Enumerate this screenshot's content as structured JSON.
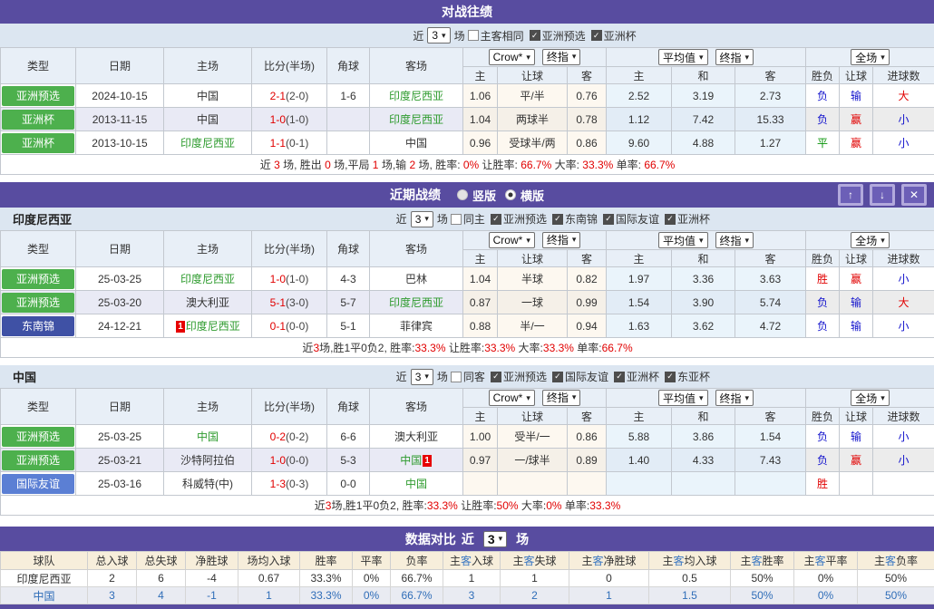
{
  "icons": {
    "chevron": "▾",
    "check": "✓",
    "up": "↑",
    "down": "↓",
    "close": "✕"
  },
  "colors": {
    "purple": "#584ca0",
    "badge_green": "#4db04d",
    "badge_navy": "#3f51a5",
    "badge_blue": "#5b7fd4",
    "result_red": "#e10000",
    "result_blue": "#1212cc",
    "result_green": "#089408",
    "team_green": "#2e9b2e"
  },
  "shared_headers": {
    "static": [
      "类型",
      "日期",
      "主场",
      "比分(半场)",
      "角球",
      "客场"
    ],
    "group_selects": [
      [
        "Crow*",
        "终指"
      ],
      [
        "平均值",
        "终指"
      ],
      [
        "全场"
      ]
    ],
    "sub": [
      "主",
      "让球",
      "客",
      "主",
      "和",
      "客",
      "胜负",
      "让球",
      "进球数"
    ]
  },
  "h2h": {
    "title": "对战往绩",
    "filter": {
      "near": "近",
      "select": "3",
      "games": "场",
      "checks": [
        {
          "label": "主客相同",
          "checked": false
        },
        {
          "label": "亚洲预选",
          "checked": true
        },
        {
          "label": "亚洲杯",
          "checked": true
        }
      ]
    },
    "table": {
      "rows": [
        {
          "league": {
            "label": "亚洲预选",
            "color": "green"
          },
          "date": "2024-10-15",
          "home": {
            "name": "中国",
            "green": false
          },
          "score_ft": "2-1",
          "score_ht": "(2-0)",
          "corner": "1-6",
          "away": {
            "name": "印度尼西亚",
            "green": true
          },
          "odds": [
            "1.06",
            "平/半",
            "0.76"
          ],
          "avg": [
            "2.52",
            "3.19",
            "2.73"
          ],
          "result": [
            {
              "t": "负",
              "c": "blue"
            },
            {
              "t": "输",
              "c": "blue"
            },
            {
              "t": "大",
              "c": "red"
            }
          ]
        },
        {
          "league": {
            "label": "亚洲杯",
            "color": "green"
          },
          "date": "2013-11-15",
          "home": {
            "name": "中国",
            "green": false
          },
          "score_ft": "1-0",
          "score_ht": "(1-0)",
          "corner": "",
          "away": {
            "name": "印度尼西亚",
            "green": true
          },
          "odds": [
            "1.04",
            "两球半",
            "0.78"
          ],
          "avg": [
            "1.12",
            "7.42",
            "15.33"
          ],
          "result": [
            {
              "t": "负",
              "c": "blue"
            },
            {
              "t": "赢",
              "c": "red"
            },
            {
              "t": "小",
              "c": "blue"
            }
          ]
        },
        {
          "league": {
            "label": "亚洲杯",
            "color": "green"
          },
          "date": "2013-10-15",
          "home": {
            "name": "印度尼西亚",
            "green": true
          },
          "score_ft": "1-1",
          "score_ht": "(0-1)",
          "corner": "",
          "away": {
            "name": "中国",
            "green": false
          },
          "odds": [
            "0.96",
            "受球半/两",
            "0.86"
          ],
          "avg": [
            "9.60",
            "4.88",
            "1.27"
          ],
          "result": [
            {
              "t": "平",
              "c": "green"
            },
            {
              "t": "赢",
              "c": "red"
            },
            {
              "t": "小",
              "c": "blue"
            }
          ]
        }
      ],
      "summary": [
        {
          "t": "近 "
        },
        {
          "t": "3",
          "c": "r"
        },
        {
          "t": " 场, 胜出 "
        },
        {
          "t": "0",
          "c": "r"
        },
        {
          "t": " 场,平局 "
        },
        {
          "t": "1",
          "c": "r"
        },
        {
          "t": " 场,输 "
        },
        {
          "t": "2",
          "c": "r"
        },
        {
          "t": " 场, 胜率: "
        },
        {
          "t": "0%",
          "c": "r"
        },
        {
          "t": " 让胜率: "
        },
        {
          "t": "66.7%",
          "c": "r"
        },
        {
          "t": " 大率: "
        },
        {
          "t": "33.3%",
          "c": "r"
        },
        {
          "t": " 单率: "
        },
        {
          "t": "66.7%",
          "c": "r"
        }
      ]
    }
  },
  "recent": {
    "title": "近期战绩",
    "radios": [
      {
        "label": "竖版",
        "selected": false
      },
      {
        "label": "横版",
        "selected": true
      }
    ],
    "buttons": {
      "up": "↑",
      "down": "↓",
      "close": "✕"
    },
    "teams": [
      {
        "label": "印度尼西亚",
        "filter": {
          "near": "近",
          "select": "3",
          "games": "场",
          "checks": [
            {
              "label": "同主",
              "checked": false
            },
            {
              "label": "亚洲预选",
              "checked": true
            },
            {
              "label": "东南锦",
              "checked": true
            },
            {
              "label": "国际友谊",
              "checked": true
            },
            {
              "label": "亚洲杯",
              "checked": true
            }
          ]
        },
        "table": {
          "rows": [
            {
              "league": {
                "label": "亚洲预选",
                "color": "green"
              },
              "date": "25-03-25",
              "home": {
                "name": "印度尼西亚",
                "green": true
              },
              "score_ft": "1-0",
              "score_ht": "(1-0)",
              "corner": "4-3",
              "away": {
                "name": "巴林",
                "green": false
              },
              "odds": [
                "1.04",
                "半球",
                "0.82"
              ],
              "avg": [
                "1.97",
                "3.36",
                "3.63"
              ],
              "result": [
                {
                  "t": "胜",
                  "c": "red"
                },
                {
                  "t": "赢",
                  "c": "red"
                },
                {
                  "t": "小",
                  "c": "blue"
                }
              ]
            },
            {
              "league": {
                "label": "亚洲预选",
                "color": "green"
              },
              "date": "25-03-20",
              "home": {
                "name": "澳大利亚",
                "green": false
              },
              "score_ft": "5-1",
              "score_ht": "(3-0)",
              "corner": "5-7",
              "away": {
                "name": "印度尼西亚",
                "green": true
              },
              "odds": [
                "0.87",
                "一球",
                "0.99"
              ],
              "avg": [
                "1.54",
                "3.90",
                "5.74"
              ],
              "result": [
                {
                  "t": "负",
                  "c": "blue"
                },
                {
                  "t": "输",
                  "c": "blue"
                },
                {
                  "t": "大",
                  "c": "red"
                }
              ]
            },
            {
              "league": {
                "label": "东南锦",
                "color": "navy"
              },
              "date": "24-12-21",
              "home": {
                "name": "印度尼西亚",
                "green": true,
                "badge": "1",
                "badge_pos": "before"
              },
              "score_ft": "0-1",
              "score_ht": "(0-0)",
              "corner": "5-1",
              "away": {
                "name": "菲律宾",
                "green": false
              },
              "odds": [
                "0.88",
                "半/一",
                "0.94"
              ],
              "avg": [
                "1.63",
                "3.62",
                "4.72"
              ],
              "result": [
                {
                  "t": "负",
                  "c": "blue"
                },
                {
                  "t": "输",
                  "c": "blue"
                },
                {
                  "t": "小",
                  "c": "blue"
                }
              ]
            }
          ],
          "summary": [
            {
              "t": "近"
            },
            {
              "t": "3",
              "c": "r"
            },
            {
              "t": "场,胜1平0负2, 胜率:"
            },
            {
              "t": "33.3%",
              "c": "r"
            },
            {
              "t": " 让胜率:"
            },
            {
              "t": "33.3%",
              "c": "r"
            },
            {
              "t": " 大率:"
            },
            {
              "t": "33.3%",
              "c": "r"
            },
            {
              "t": " 单率:"
            },
            {
              "t": "66.7%",
              "c": "r"
            }
          ]
        }
      },
      {
        "label": "中国",
        "filter": {
          "near": "近",
          "select": "3",
          "games": "场",
          "checks": [
            {
              "label": "同客",
              "checked": false
            },
            {
              "label": "亚洲预选",
              "checked": true
            },
            {
              "label": "国际友谊",
              "checked": true
            },
            {
              "label": "亚洲杯",
              "checked": true
            },
            {
              "label": "东亚杯",
              "checked": true
            }
          ]
        },
        "table": {
          "rows": [
            {
              "league": {
                "label": "亚洲预选",
                "color": "green"
              },
              "date": "25-03-25",
              "home": {
                "name": "中国",
                "green": true
              },
              "score_ft": "0-2",
              "score_ht": "(0-2)",
              "corner": "6-6",
              "away": {
                "name": "澳大利亚",
                "green": false
              },
              "odds": [
                "1.00",
                "受半/一",
                "0.86"
              ],
              "avg": [
                "5.88",
                "3.86",
                "1.54"
              ],
              "result": [
                {
                  "t": "负",
                  "c": "blue"
                },
                {
                  "t": "输",
                  "c": "blue"
                },
                {
                  "t": "小",
                  "c": "blue"
                }
              ]
            },
            {
              "league": {
                "label": "亚洲预选",
                "color": "green"
              },
              "date": "25-03-21",
              "home": {
                "name": "沙特阿拉伯",
                "green": false
              },
              "score_ft": "1-0",
              "score_ht": "(0-0)",
              "corner": "5-3",
              "away": {
                "name": "中国",
                "green": true,
                "badge": "1",
                "badge_pos": "after"
              },
              "odds": [
                "0.97",
                "一/球半",
                "0.89"
              ],
              "avg": [
                "1.40",
                "4.33",
                "7.43"
              ],
              "result": [
                {
                  "t": "负",
                  "c": "blue"
                },
                {
                  "t": "赢",
                  "c": "red"
                },
                {
                  "t": "小",
                  "c": "blue"
                }
              ]
            },
            {
              "league": {
                "label": "国际友谊",
                "color": "blue"
              },
              "date": "25-03-16",
              "home": {
                "name": "科威特(中)",
                "green": false
              },
              "score_ft": "1-3",
              "score_ht": "(0-3)",
              "corner": "0-0",
              "away": {
                "name": "中国",
                "green": true
              },
              "odds": [
                "",
                "",
                ""
              ],
              "avg": [
                "",
                "",
                ""
              ],
              "result": [
                {
                  "t": "胜",
                  "c": "red"
                },
                {
                  "t": ""
                },
                {
                  "t": ""
                }
              ]
            }
          ],
          "summary": [
            {
              "t": "近"
            },
            {
              "t": "3",
              "c": "r"
            },
            {
              "t": "场,胜1平0负2, 胜率:"
            },
            {
              "t": "33.3%",
              "c": "r"
            },
            {
              "t": " 让胜率:"
            },
            {
              "t": "50%",
              "c": "r"
            },
            {
              "t": " 大率:"
            },
            {
              "t": "0%",
              "c": "r"
            },
            {
              "t": " 单率:"
            },
            {
              "t": "33.3%",
              "c": "r"
            }
          ]
        }
      }
    ]
  },
  "compare": {
    "title": "数据对比",
    "near": "近",
    "select": "3",
    "games": "场",
    "headers": [
      [
        {
          "t": "球队"
        }
      ],
      [
        {
          "t": "总入球"
        }
      ],
      [
        {
          "t": "总失球"
        }
      ],
      [
        {
          "t": "净胜球"
        }
      ],
      [
        {
          "t": "场均入球"
        }
      ],
      [
        {
          "t": "胜率"
        }
      ],
      [
        {
          "t": "平率"
        }
      ],
      [
        {
          "t": "负率"
        }
      ],
      [
        {
          "t": "主"
        },
        {
          "t": "客",
          "c": "hb"
        },
        {
          "t": "入球"
        }
      ],
      [
        {
          "t": "主"
        },
        {
          "t": "客",
          "c": "hb"
        },
        {
          "t": "失球"
        }
      ],
      [
        {
          "t": "主"
        },
        {
          "t": "客",
          "c": "hb"
        },
        {
          "t": "净胜球"
        }
      ],
      [
        {
          "t": "主"
        },
        {
          "t": "客",
          "c": "hb"
        },
        {
          "t": "均入球"
        }
      ],
      [
        {
          "t": "主"
        },
        {
          "t": "客",
          "c": "hb"
        },
        {
          "t": "胜率"
        }
      ],
      [
        {
          "t": "主"
        },
        {
          "t": "客",
          "c": "hb"
        },
        {
          "t": "平率"
        }
      ],
      [
        {
          "t": "主"
        },
        {
          "t": "客",
          "c": "hb"
        },
        {
          "t": "负率"
        }
      ]
    ],
    "rows": [
      [
        "印度尼西亚",
        "2",
        "6",
        "-4",
        "0.67",
        "33.3%",
        "0%",
        "66.7%",
        "1",
        "1",
        "0",
        "0.5",
        "50%",
        "0%",
        "50%"
      ],
      [
        "中国",
        "3",
        "4",
        "-1",
        "1",
        "33.3%",
        "0%",
        "66.7%",
        "3",
        "2",
        "1",
        "1.5",
        "50%",
        "0%",
        "50%"
      ]
    ]
  }
}
